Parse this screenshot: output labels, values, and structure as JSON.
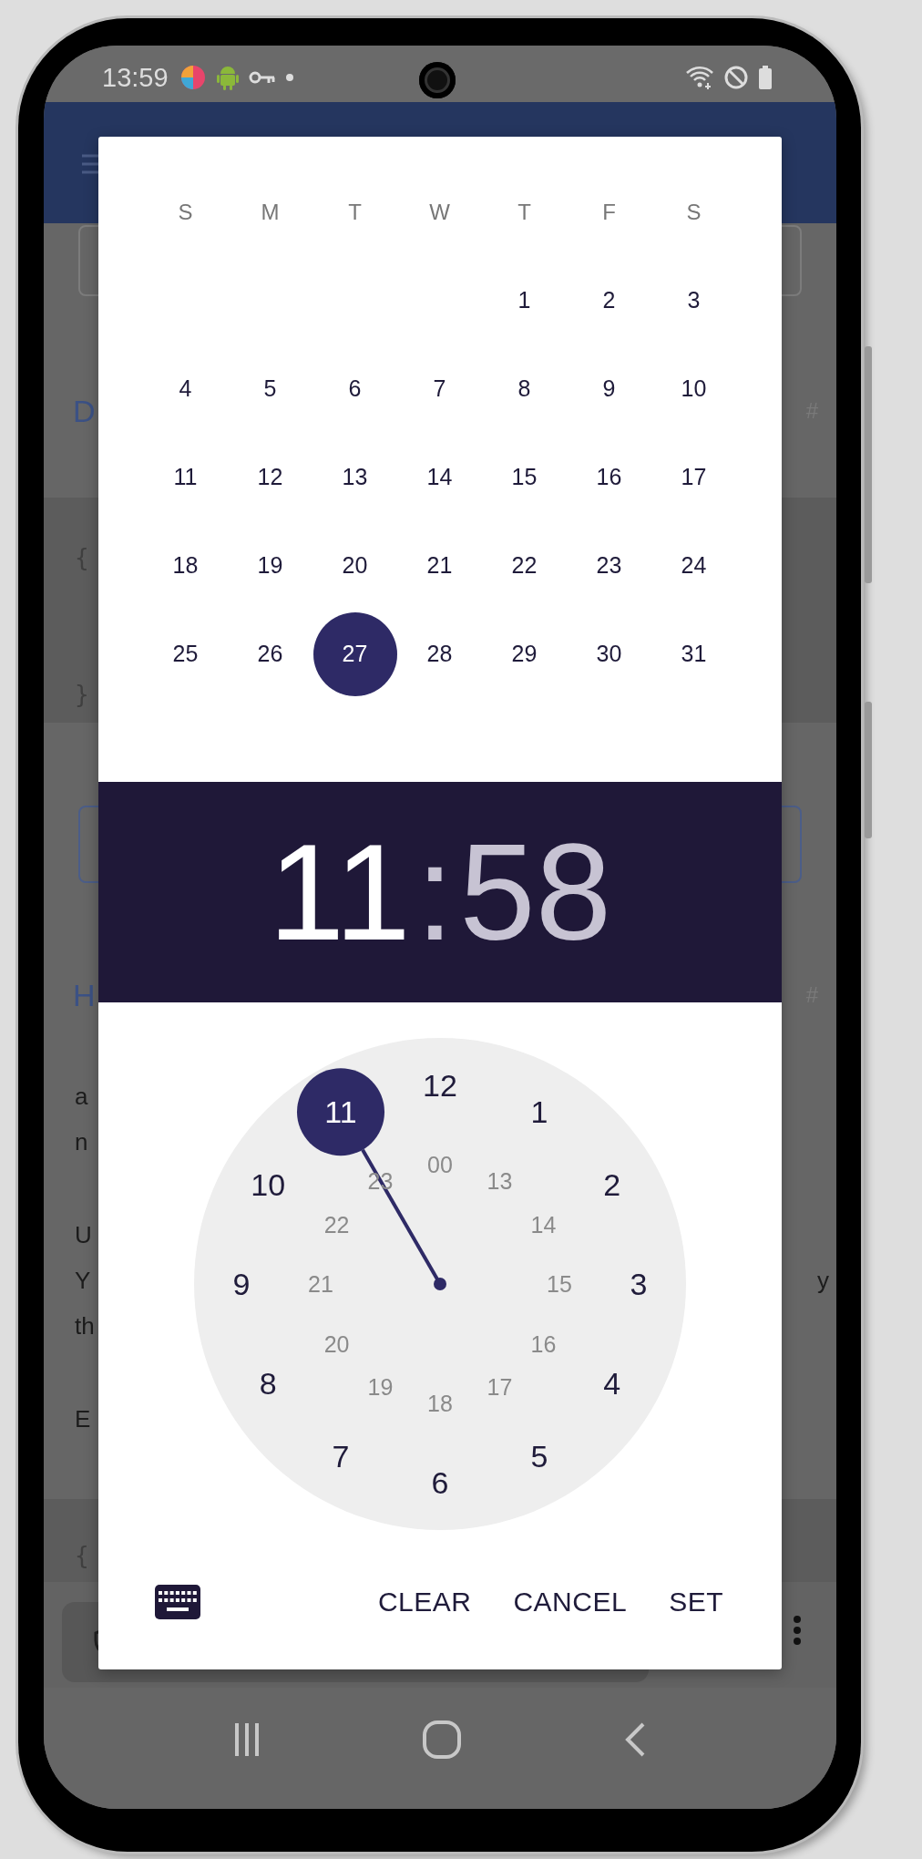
{
  "status_bar": {
    "time": "13:59"
  },
  "background": {
    "section_1": {
      "heading": "D",
      "anchor": "#"
    },
    "code_1": [
      "{",
      "}"
    ],
    "section_2": {
      "heading": "H",
      "anchor": "#",
      "paragraphs": [
        [
          {
            "left": "a"
          },
          {
            "left": "n"
          }
        ],
        [
          {
            "left": "U"
          },
          {
            "left": "Y",
            "right": "y"
          },
          {
            "left": "th"
          }
        ],
        [
          {
            "left": "E"
          }
        ]
      ]
    },
    "code_2": [
      "{"
    ]
  },
  "calendar": {
    "weekdays": [
      "S",
      "M",
      "T",
      "W",
      "T",
      "F",
      "S"
    ],
    "weeks": [
      [
        {
          "day": "1",
          "selected": false
        },
        {
          "day": "2",
          "selected": false
        },
        {
          "day": "3",
          "selected": false
        }
      ],
      [
        {
          "day": "4",
          "selected": false
        },
        {
          "day": "5",
          "selected": false
        },
        {
          "day": "6",
          "selected": false
        },
        {
          "day": "7",
          "selected": false
        },
        {
          "day": "8",
          "selected": false
        },
        {
          "day": "9",
          "selected": false
        },
        {
          "day": "10",
          "selected": false
        }
      ],
      [
        {
          "day": "11",
          "selected": false
        },
        {
          "day": "12",
          "selected": false
        },
        {
          "day": "13",
          "selected": false
        },
        {
          "day": "14",
          "selected": false
        },
        {
          "day": "15",
          "selected": false
        },
        {
          "day": "16",
          "selected": false
        },
        {
          "day": "17",
          "selected": false
        }
      ],
      [
        {
          "day": "18",
          "selected": false
        },
        {
          "day": "19",
          "selected": false
        },
        {
          "day": "20",
          "selected": false
        },
        {
          "day": "21",
          "selected": false
        },
        {
          "day": "22",
          "selected": false
        },
        {
          "day": "23",
          "selected": false
        },
        {
          "day": "24",
          "selected": false
        }
      ],
      [
        {
          "day": "25",
          "selected": false
        },
        {
          "day": "26",
          "selected": false
        },
        {
          "day": "27",
          "selected": true
        },
        {
          "day": "28",
          "selected": false
        },
        {
          "day": "29",
          "selected": false
        },
        {
          "day": "30",
          "selected": false
        },
        {
          "day": "31",
          "selected": false
        }
      ]
    ]
  },
  "time": {
    "hour": "11",
    "separator": ":",
    "minute": "58",
    "hour_selected": true,
    "minute_selected": false
  },
  "clock": {
    "outer": [
      {
        "label": "12",
        "selected": false
      },
      {
        "label": "1",
        "selected": false
      },
      {
        "label": "2",
        "selected": false
      },
      {
        "label": "3",
        "selected": false
      },
      {
        "label": "4",
        "selected": false
      },
      {
        "label": "5",
        "selected": false
      },
      {
        "label": "6",
        "selected": false
      },
      {
        "label": "7",
        "selected": false
      },
      {
        "label": "8",
        "selected": false
      },
      {
        "label": "9",
        "selected": false
      },
      {
        "label": "10",
        "selected": false
      },
      {
        "label": "11",
        "selected": true
      }
    ],
    "inner": [
      {
        "label": "00",
        "selected": false
      },
      {
        "label": "13",
        "selected": false
      },
      {
        "label": "14",
        "selected": false
      },
      {
        "label": "15",
        "selected": false
      },
      {
        "label": "16",
        "selected": false
      },
      {
        "label": "17",
        "selected": false
      },
      {
        "label": "18",
        "selected": false
      },
      {
        "label": "19",
        "selected": false
      },
      {
        "label": "20",
        "selected": false
      },
      {
        "label": "21",
        "selected": false
      },
      {
        "label": "22",
        "selected": false
      },
      {
        "label": "23",
        "selected": false
      }
    ]
  },
  "buttons": [
    "CLEAR",
    "CANCEL",
    "SET"
  ]
}
